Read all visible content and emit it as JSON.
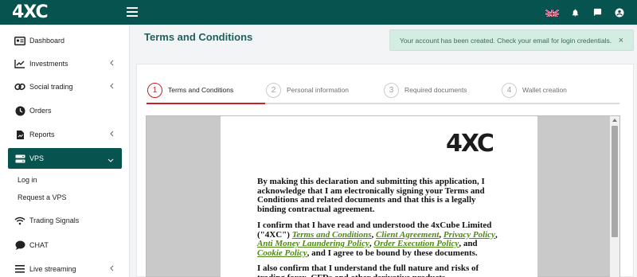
{
  "topbar": {
    "logo": "4XC",
    "icons": [
      "uk-flag-icon",
      "bell-icon",
      "chat-icon",
      "account-icon"
    ]
  },
  "sidebar": {
    "items": [
      {
        "label": "Dashboard",
        "icon": "dashboard-icon"
      },
      {
        "label": "Investments",
        "icon": "chart-line-icon",
        "expandable": true
      },
      {
        "label": "Social trading",
        "icon": "link-icon",
        "expandable": true
      },
      {
        "label": "Orders",
        "icon": "orders-icon"
      },
      {
        "label": "Reports",
        "icon": "report-icon",
        "expandable": true
      },
      {
        "label": "VPS",
        "icon": "server-icon",
        "expanded": true,
        "active": true
      },
      {
        "label": "Trading Signals",
        "icon": "wifi-icon"
      },
      {
        "label": "CHAT",
        "icon": "chat-bubble-icon"
      },
      {
        "label": "Live streaming",
        "icon": "menu-icon",
        "expandable": true
      }
    ],
    "vps_sub": [
      "Log in",
      "Request a VPS"
    ]
  },
  "main": {
    "title": "Terms and Conditions",
    "alert": "Your account has been created. Check your email for login credentials.",
    "alert_close": "×"
  },
  "stepper": {
    "steps": [
      {
        "num": "1",
        "label": "Terms and Conditions"
      },
      {
        "num": "2",
        "label": "Personal information"
      },
      {
        "num": "3",
        "label": "Required documents"
      },
      {
        "num": "4",
        "label": "Wallet creation"
      }
    ],
    "active_step": 1
  },
  "document": {
    "logo": "4XC",
    "p1": "By making this declaration and submitting this application, I acknowledge that I am electronically signing your Terms and Conditions and related documents and that this is a legally binding contractual agreement.",
    "p2_a": "I confirm that I have read and understood the 4xCube Limited (\"4XC\")",
    "link_terms": "Terms and Conditions",
    "link_client": "Client Agreement",
    "link_privacy": "Privacy Policy",
    "link_aml": "Anti Money Laundering Policy",
    "link_execution": "Order Execution Policy",
    "link_cookie": "Cookie Policy",
    "p2_end": ", and I agree to be bound by these documents.",
    "p3": "I also confirm that I understand the full nature and risks of trading forex, CFDs and other derivative products."
  },
  "colors": {
    "brand": "#07534f",
    "accent_red": "#c9202b",
    "alert_bg": "#d4ede3",
    "link_green": "#4d8a12"
  }
}
